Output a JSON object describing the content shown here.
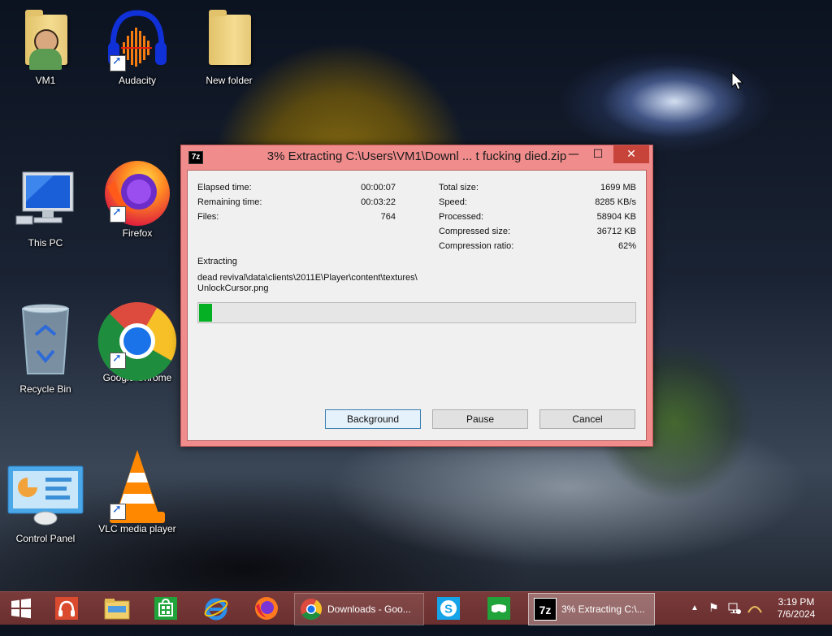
{
  "desktop": {
    "icons": [
      {
        "label": "VM1"
      },
      {
        "label": "Audacity"
      },
      {
        "label": "New folder"
      },
      {
        "label": "This PC"
      },
      {
        "label": "Firefox"
      },
      {
        "label": "Recycle Bin"
      },
      {
        "label": "Google Chrome"
      },
      {
        "label": "Control Panel"
      },
      {
        "label": "VLC media player"
      }
    ]
  },
  "dialog": {
    "app_icon": "7z",
    "title": "3% Extracting C:\\Users\\VM1\\Downl ... t fucking died.zip",
    "controls": {
      "minimize": "—",
      "maximize": "☐",
      "close": "✕"
    },
    "left_stats": [
      {
        "label": "Elapsed time:",
        "value": "00:00:07"
      },
      {
        "label": "Remaining time:",
        "value": "00:03:22"
      },
      {
        "label": "Files:",
        "value": "764"
      }
    ],
    "right_stats": [
      {
        "label": "Total size:",
        "value": "1699 MB"
      },
      {
        "label": "Speed:",
        "value": "8285 KB/s"
      },
      {
        "label": "Processed:",
        "value": "58904 KB"
      },
      {
        "label": "Compressed size:",
        "value": "36712 KB"
      },
      {
        "label": "Compression ratio:",
        "value": "62%"
      }
    ],
    "status_label": "Extracting",
    "current_path_line1": "dead revival\\data\\clients\\2011E\\Player\\content\\textures\\",
    "current_path_line2": "UnlockCursor.png",
    "progress_fraction": 0.03,
    "progress_color": "#06b025",
    "buttons": {
      "background": "Background",
      "pause": "Pause",
      "cancel": "Cancel"
    }
  },
  "taskbar": {
    "start_icon": "windows-logo-icon",
    "pinned": [
      "headphones-app-icon",
      "file-explorer-icon",
      "store-icon",
      "internet-explorer-icon",
      "firefox-icon"
    ],
    "tasks": [
      {
        "label": "Downloads - Goo...",
        "icon": "chrome-icon"
      },
      {
        "label": "3% Extracting C:\\...",
        "icon": "7zip-icon"
      }
    ],
    "pinned_after": [
      "skype-icon",
      "xbox-games-icon"
    ],
    "time": "3:19 PM",
    "date": "7/6/2024"
  },
  "colors": {
    "dialog_frame": "#f08c8c",
    "close_button": "#c7443b",
    "taskbar": "#6a2f2f"
  }
}
